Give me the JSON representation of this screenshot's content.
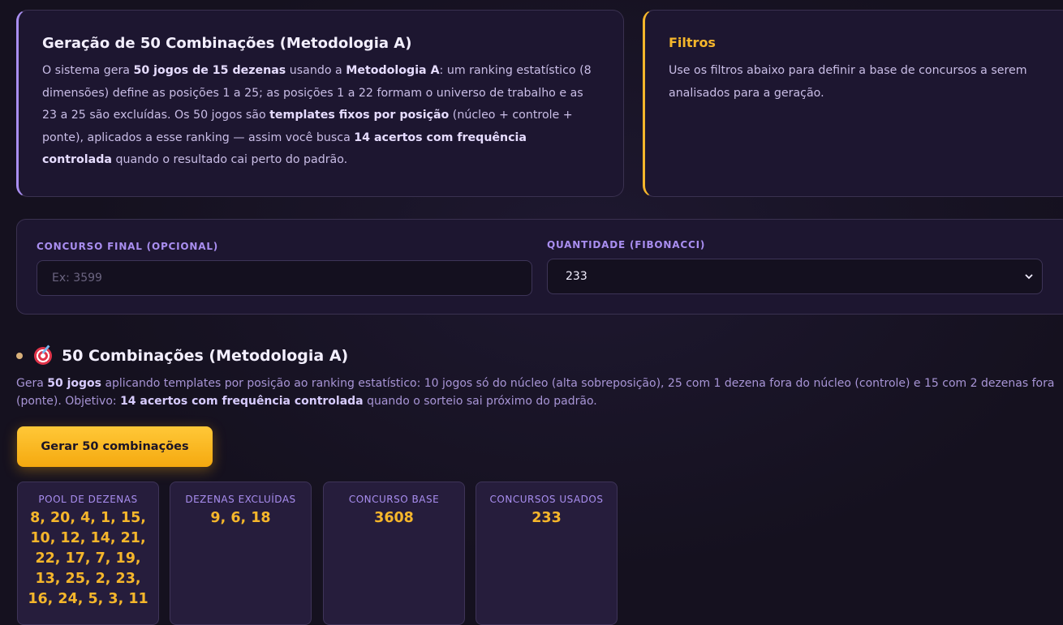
{
  "method_card": {
    "title": "Geração de 50 Combinações (Metodologia A)",
    "p1": "O sistema gera ",
    "b1": "50 jogos de 15 dezenas",
    "p2": " usando a ",
    "b2": "Metodologia A",
    "p3": ": um ranking estatístico (8 dimensões) define as posições 1 a 25; as posições 1 a 22 formam o universo de trabalho e as 23 a 25 são excluídas. Os 50 jogos são ",
    "b3": "templates fixos por posição",
    "p4": " (núcleo + controle + ponte), aplicados a esse ranking — assim você busca ",
    "b4": "14 acertos com frequência controlada",
    "p5": " quando o resultado cai perto do padrão."
  },
  "filters_card": {
    "title": "Filtros",
    "text": "Use os filtros abaixo para definir a base de concursos a serem analisados para a geração."
  },
  "form": {
    "concurso_label": "CONCURSO FINAL (OPCIONAL)",
    "concurso_placeholder": "Ex: 3599",
    "quantidade_label": "QUANTIDADE (FIBONACCI)",
    "quantidade_value": "233"
  },
  "section": {
    "title": "50 Combinações (Metodologia A)",
    "d1": "Gera ",
    "db1": "50 jogos",
    "d2": " aplicando templates por posição ao ranking estatístico: 10 jogos só do núcleo (alta sobreposição), 25 com 1 dezena fora do núcleo (controle) e 15 com 2 dezenas fora (ponte). Objetivo: ",
    "db2": "14 acertos com frequência controlada",
    "d3": " quando o sorteio sai próximo do padrão.",
    "button_label": "Gerar 50 combinações"
  },
  "stats": [
    {
      "label": "POOL DE DEZENAS",
      "value": "8, 20, 4, 1, 15, 10, 12, 14, 21, 22, 17, 7, 19, 13, 25, 2, 23, 16, 24, 5, 3, 11"
    },
    {
      "label": "DEZENAS EXCLUÍDAS",
      "value": "9, 6, 18"
    },
    {
      "label": "CONCURSO BASE",
      "value": "3608"
    },
    {
      "label": "CONCURSOS USADOS",
      "value": "233"
    }
  ],
  "icons": {
    "section_icon": "target-icon",
    "select_icon": "chevron-down-icon"
  },
  "colors": {
    "accent_purple": "#a98ef0",
    "accent_gold": "#f5b62b"
  }
}
